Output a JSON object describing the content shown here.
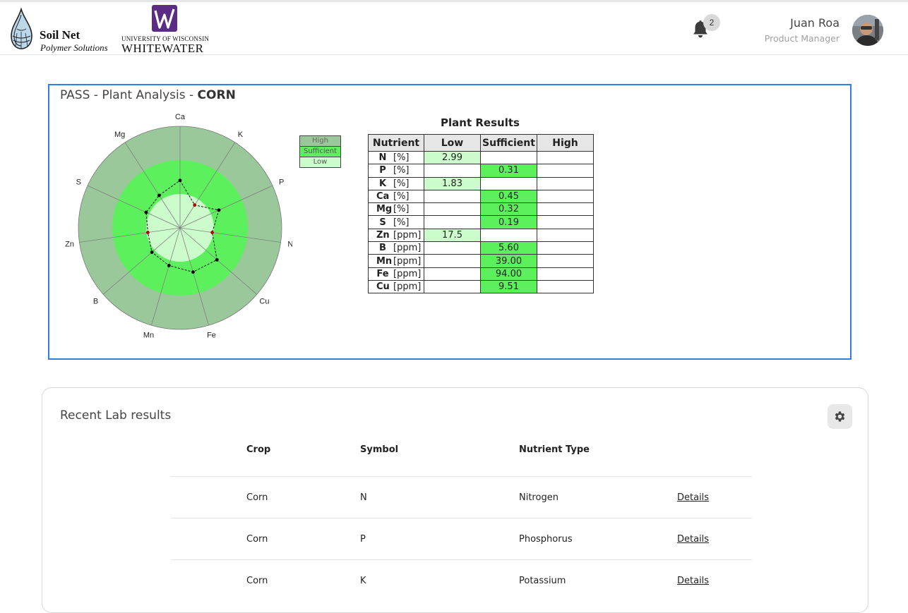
{
  "brand": {
    "name": "Soil Net",
    "tagline": "Polymer Solutions",
    "university_line1": "UNIVERSITY OF WISCONSIN",
    "university_line2": "WHITEWATER"
  },
  "header": {
    "notification_count": "2",
    "user_name": "Juan Roa",
    "user_role": "Product Manager"
  },
  "analysis": {
    "title_prefix": "PASS - Plant Analysis - ",
    "crop": "CORN",
    "legend": [
      "High",
      "Sufficient",
      "Low"
    ],
    "results_title": "Plant Results",
    "columns": [
      "Nutrient",
      "Low",
      "Sufficient",
      "High"
    ],
    "rows": [
      {
        "symbol": "N",
        "unit": "[%]",
        "low": "2.99",
        "sufficient": "",
        "high": ""
      },
      {
        "symbol": "P",
        "unit": "[%]",
        "low": "",
        "sufficient": "0.31",
        "high": ""
      },
      {
        "symbol": "K",
        "unit": "[%]",
        "low": "1.83",
        "sufficient": "",
        "high": ""
      },
      {
        "symbol": "Ca",
        "unit": "[%]",
        "low": "",
        "sufficient": "0.45",
        "high": ""
      },
      {
        "symbol": "Mg",
        "unit": "[%]",
        "low": "",
        "sufficient": "0.32",
        "high": ""
      },
      {
        "symbol": "S",
        "unit": "[%]",
        "low": "",
        "sufficient": "0.19",
        "high": ""
      },
      {
        "symbol": "Zn",
        "unit": "[ppm]",
        "low": "17.5",
        "sufficient": "",
        "high": ""
      },
      {
        "symbol": "B",
        "unit": "[ppm]",
        "low": "",
        "sufficient": "5.60",
        "high": ""
      },
      {
        "symbol": "Mn",
        "unit": "[ppm]",
        "low": "",
        "sufficient": "39.00",
        "high": ""
      },
      {
        "symbol": "Fe",
        "unit": "[ppm]",
        "low": "",
        "sufficient": "94.00",
        "high": ""
      },
      {
        "symbol": "Cu",
        "unit": "[ppm]",
        "low": "",
        "sufficient": "9.51",
        "high": ""
      }
    ]
  },
  "chart_data": {
    "type": "radar",
    "axes": [
      "N",
      "K",
      "Ca",
      "Mg",
      "S",
      "Zn",
      "B",
      "Mn",
      "Fe",
      "Cu",
      "P"
    ],
    "bands": [
      "Low",
      "Sufficient",
      "High"
    ],
    "band_colors": {
      "Low": "#ccfccc",
      "Sufficient": "#5df05d",
      "High": "#9ac89a"
    },
    "values": [
      0.48,
      0.4,
      0.7,
      0.57,
      0.55,
      0.48,
      0.55,
      0.58,
      0.68,
      0.72,
      0.63
    ],
    "low_flagged": [
      "N",
      "K",
      "Zn"
    ],
    "point_colors": {
      "low": "#b00000",
      "normal": "#000000"
    }
  },
  "lab_results": {
    "title": "Recent Lab results",
    "columns": [
      "Crop",
      "Symbol",
      "Nutrient Type",
      ""
    ],
    "rows": [
      {
        "crop": "Corn",
        "symbol": "N",
        "type": "Nitrogen",
        "link": "Details"
      },
      {
        "crop": "Corn",
        "symbol": "P",
        "type": "Phosphorus",
        "link": "Details"
      },
      {
        "crop": "Corn",
        "symbol": "K",
        "type": "Potassium",
        "link": "Details"
      }
    ]
  }
}
